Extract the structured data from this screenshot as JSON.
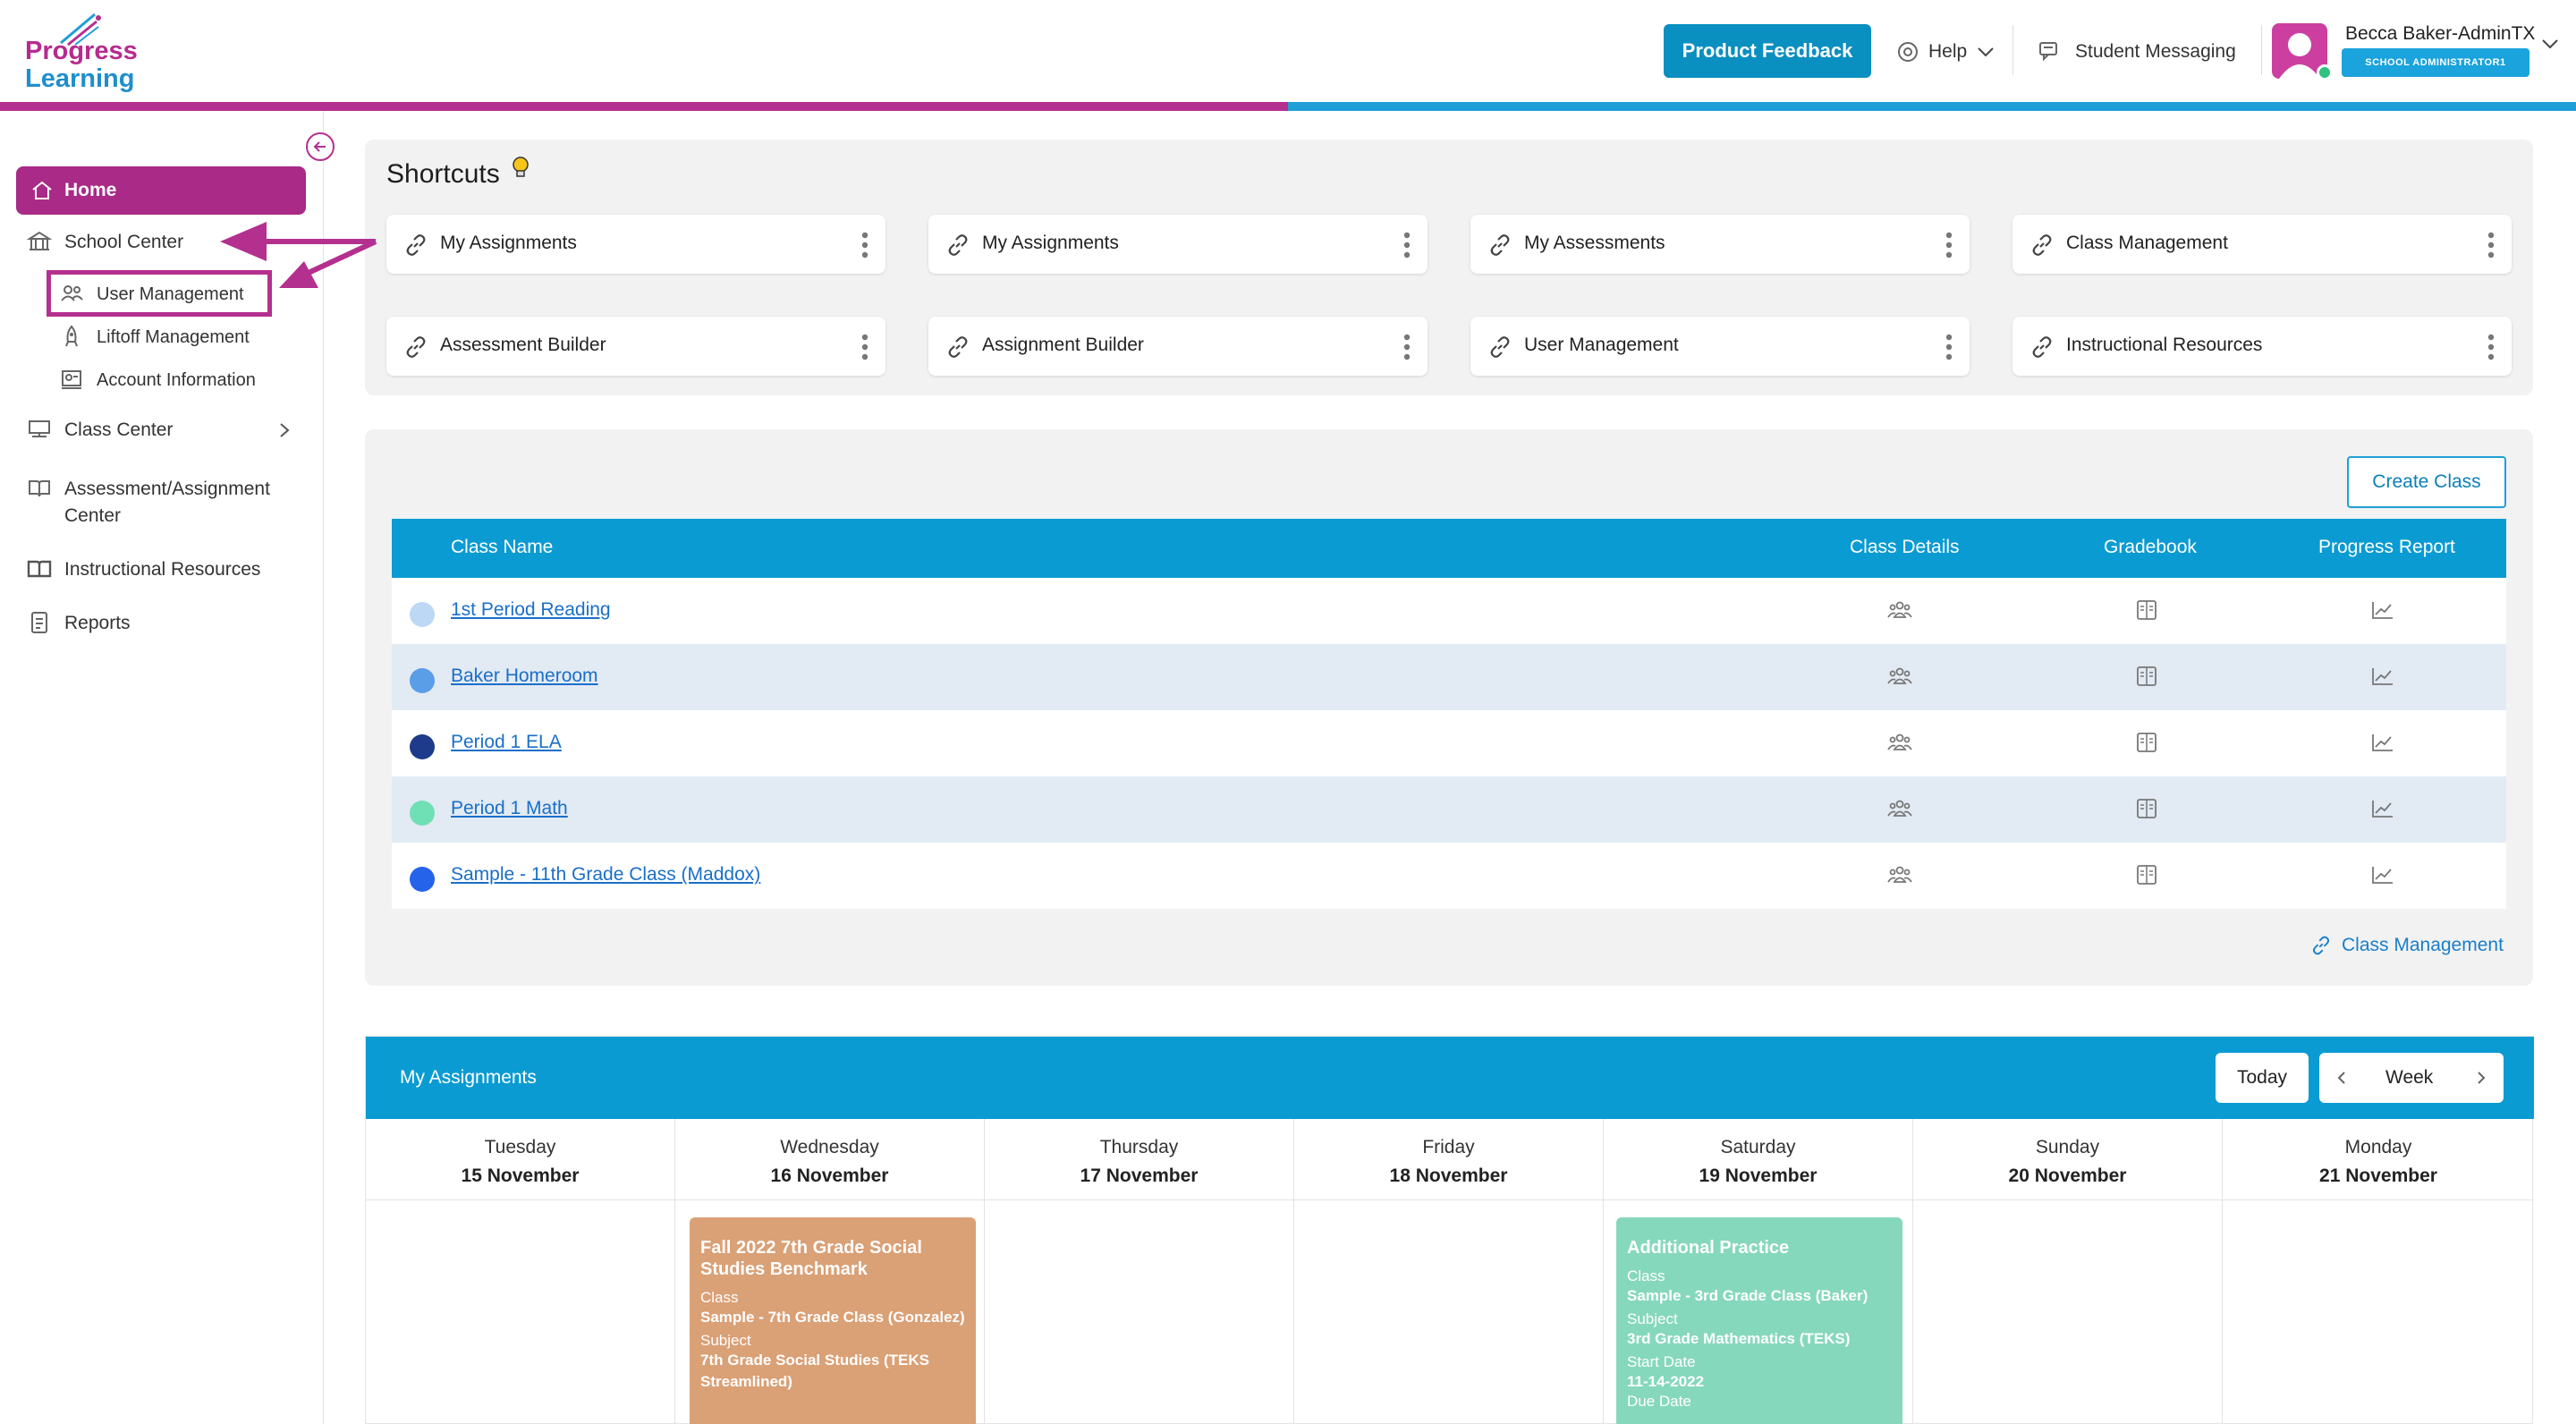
{
  "brand": {
    "line1": "Progress",
    "line2": "Learning",
    "pink": "#b4308f",
    "blue": "#1f9fd6"
  },
  "header": {
    "feedback_label": "Product Feedback",
    "help_label": "Help",
    "messaging_label": "Student Messaging",
    "user_name": "Becca Baker-AdminTX",
    "user_role": "SCHOOL ADMINISTRATOR1"
  },
  "sidebar": {
    "home": "Home",
    "school_center": "School Center",
    "user_management": "User Management",
    "liftoff_management": "Liftoff Management",
    "account_information": "Account Information",
    "class_center": "Class Center",
    "assessment_center_line1": "Assessment/Assignment",
    "assessment_center_line2": "Center",
    "instructional_resources": "Instructional Resources",
    "reports": "Reports"
  },
  "shortcuts": {
    "title": "Shortcuts",
    "items": [
      {
        "label": "My Assignments"
      },
      {
        "label": "My Assignments"
      },
      {
        "label": "My Assessments"
      },
      {
        "label": "Class Management"
      },
      {
        "label": "Assessment Builder"
      },
      {
        "label": "Assignment Builder"
      },
      {
        "label": "User Management"
      },
      {
        "label": "Instructional Resources"
      }
    ]
  },
  "classes": {
    "create_label": "Create Class",
    "columns": {
      "name": "Class Name",
      "details": "Class Details",
      "gradebook": "Gradebook",
      "progress": "Progress Report"
    },
    "rows": [
      {
        "name": "1st Period Reading",
        "color": "#bcd8f5"
      },
      {
        "name": "Baker Homeroom",
        "color": "#5a9ee8"
      },
      {
        "name": "Period 1 ELA",
        "color": "#1e3a8a"
      },
      {
        "name": "Period 1 Math",
        "color": "#6fe0b5"
      },
      {
        "name": "Sample - 11th Grade Class (Maddox)",
        "color": "#2563eb"
      }
    ],
    "footer_link": "Class Management"
  },
  "assignments": {
    "title": "My Assignments",
    "today_label": "Today",
    "view_label": "Week",
    "days": [
      {
        "name": "Tuesday",
        "date": "15 November"
      },
      {
        "name": "Wednesday",
        "date": "16 November"
      },
      {
        "name": "Thursday",
        "date": "17 November"
      },
      {
        "name": "Friday",
        "date": "18 November"
      },
      {
        "name": "Saturday",
        "date": "19 November"
      },
      {
        "name": "Sunday",
        "date": "20 November"
      },
      {
        "name": "Monday",
        "date": "21 November"
      }
    ],
    "events": [
      {
        "title": "Fall 2022 7th Grade Social Studies Benchmark",
        "class_key": "Class",
        "class_val": "Sample - 7th Grade Class (Gonzalez)",
        "subject_key": "Subject",
        "subject_val": "7th Grade Social Studies (TEKS Streamlined)"
      },
      {
        "title": "Additional Practice",
        "class_key": "Class",
        "class_val": "Sample - 3rd Grade Class (Baker)",
        "subject_key": "Subject",
        "subject_val": "3rd Grade Mathematics (TEKS)",
        "start_key": "Start Date",
        "start_val": "11-14-2022",
        "due_key": "Due Date"
      }
    ]
  }
}
